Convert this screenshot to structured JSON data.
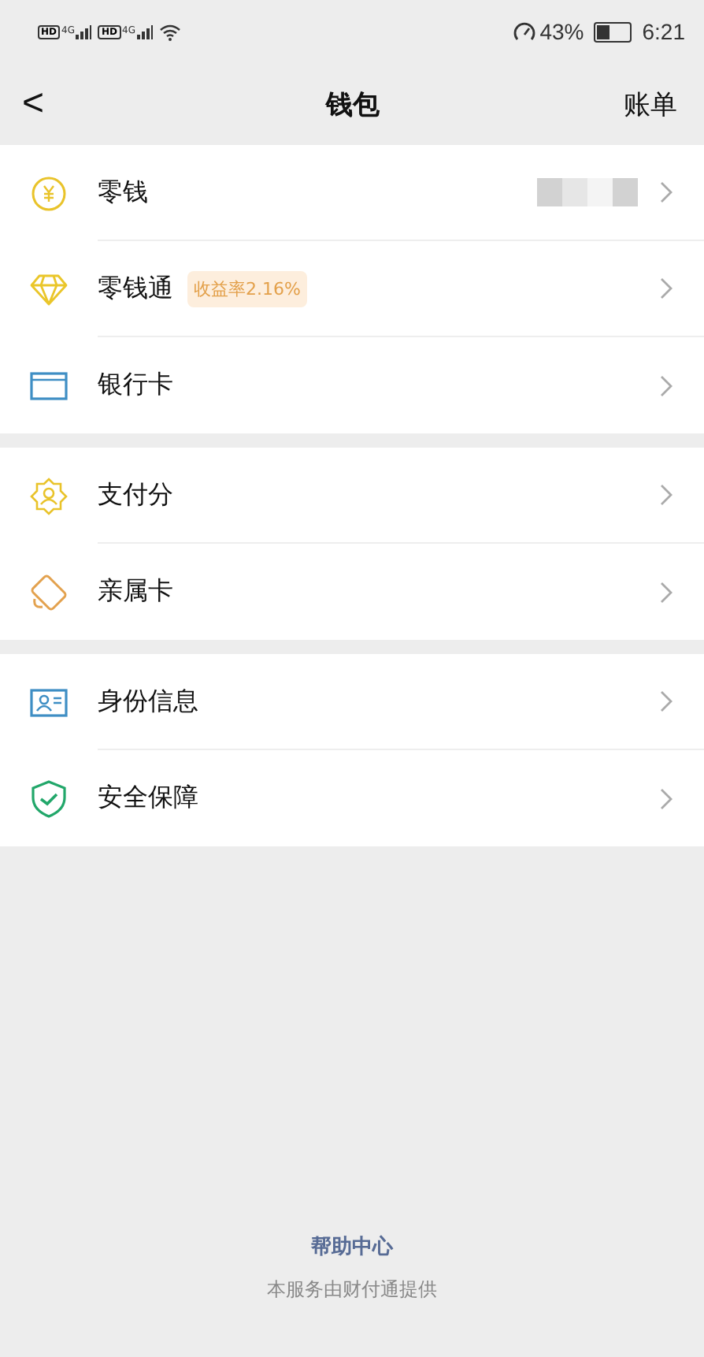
{
  "status_bar": {
    "sims": [
      {
        "hd": "HD",
        "network": "4G"
      },
      {
        "hd": "HD",
        "network": "4G"
      }
    ],
    "battery_text": "43%",
    "time": "6:21"
  },
  "nav": {
    "back": "<",
    "title": "钱包",
    "action": "账单"
  },
  "sections": [
    {
      "items": [
        {
          "kind": "yuan",
          "label": "零钱",
          "blurred_value": true
        },
        {
          "kind": "diamond",
          "label": "零钱通",
          "badge": "收益率2.16%",
          "blurred_value": false
        },
        {
          "kind": "card",
          "label": "银行卡",
          "blurred_value": false
        }
      ]
    },
    {
      "items": [
        {
          "kind": "score",
          "label": "支付分",
          "blurred_value": false
        },
        {
          "kind": "family",
          "label": "亲属卡",
          "blurred_value": false
        }
      ]
    },
    {
      "items": [
        {
          "kind": "id",
          "label": "身份信息",
          "blurred_value": false
        },
        {
          "kind": "shield",
          "label": "安全保障",
          "blurred_value": false
        }
      ]
    }
  ],
  "footer": {
    "link": "帮助中心",
    "note": "本服务由财付通提供"
  }
}
